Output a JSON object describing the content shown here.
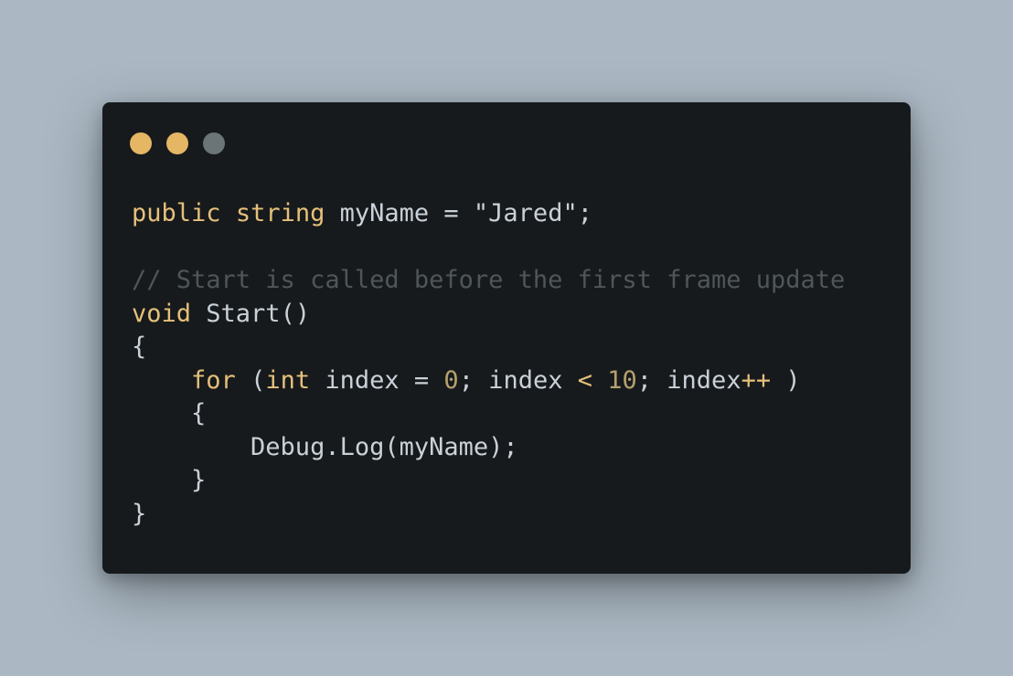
{
  "window": {
    "dot_colors": [
      "#e5b664",
      "#e5b664",
      "#6b7476"
    ]
  },
  "colors": {
    "keyword": "#e5c07b",
    "plain": "#c9d1d9",
    "comment": "#4f5659",
    "number": "#b3a06d",
    "operator": "#e5c07b"
  },
  "code_lines": [
    [
      {
        "t": "public",
        "c": "keyword"
      },
      {
        "t": " ",
        "c": "plain"
      },
      {
        "t": "string",
        "c": "keyword"
      },
      {
        "t": " myName = \"Jared\";",
        "c": "plain"
      }
    ],
    [],
    [
      {
        "t": "// Start is called before the first frame update",
        "c": "comment"
      }
    ],
    [
      {
        "t": "void",
        "c": "keyword"
      },
      {
        "t": " Start()",
        "c": "plain"
      }
    ],
    [
      {
        "t": "{",
        "c": "plain"
      }
    ],
    [
      {
        "t": "    ",
        "c": "plain"
      },
      {
        "t": "for",
        "c": "keyword"
      },
      {
        "t": " (",
        "c": "plain"
      },
      {
        "t": "int",
        "c": "keyword"
      },
      {
        "t": " index = ",
        "c": "plain"
      },
      {
        "t": "0",
        "c": "number"
      },
      {
        "t": "; index ",
        "c": "plain"
      },
      {
        "t": "<",
        "c": "operator"
      },
      {
        "t": " ",
        "c": "plain"
      },
      {
        "t": "10",
        "c": "number"
      },
      {
        "t": "; index",
        "c": "plain"
      },
      {
        "t": "++",
        "c": "operator"
      },
      {
        "t": " )",
        "c": "plain"
      }
    ],
    [
      {
        "t": "    {",
        "c": "plain"
      }
    ],
    [
      {
        "t": "        Debug.Log(myName);",
        "c": "plain"
      }
    ],
    [
      {
        "t": "    }",
        "c": "plain"
      }
    ],
    [
      {
        "t": "}",
        "c": "plain"
      }
    ]
  ]
}
